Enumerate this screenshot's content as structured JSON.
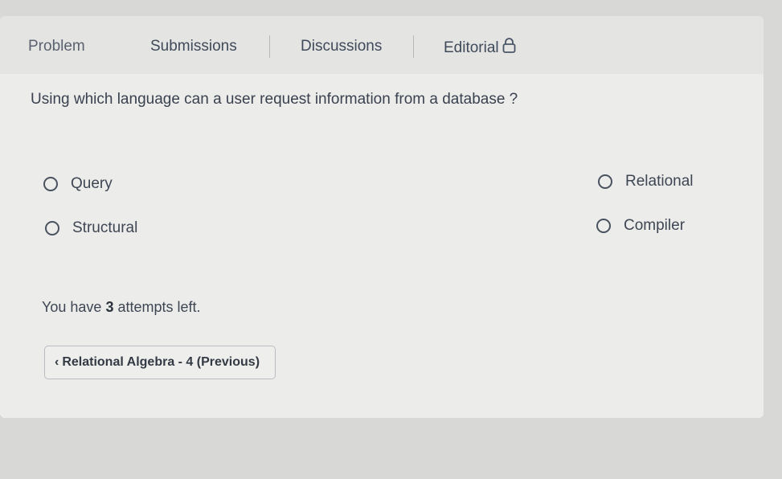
{
  "tabs": [
    {
      "label": "Problem",
      "active": true
    },
    {
      "label": "Submissions"
    },
    {
      "label": "Discussions"
    },
    {
      "label": "Editorial",
      "icon": "lock-icon"
    }
  ],
  "question": "Using which language can a user request information from a database ?",
  "options": {
    "a": "Query",
    "b": "Structural",
    "c": "Relational",
    "d": "Compiler"
  },
  "attempts": {
    "prefix": "You have",
    "count": "3",
    "suffix": "attempts left."
  },
  "navigation": {
    "previous_label": "Relational Algebra - 4 (Previous)",
    "previous_icon": "chevron-left-icon"
  }
}
